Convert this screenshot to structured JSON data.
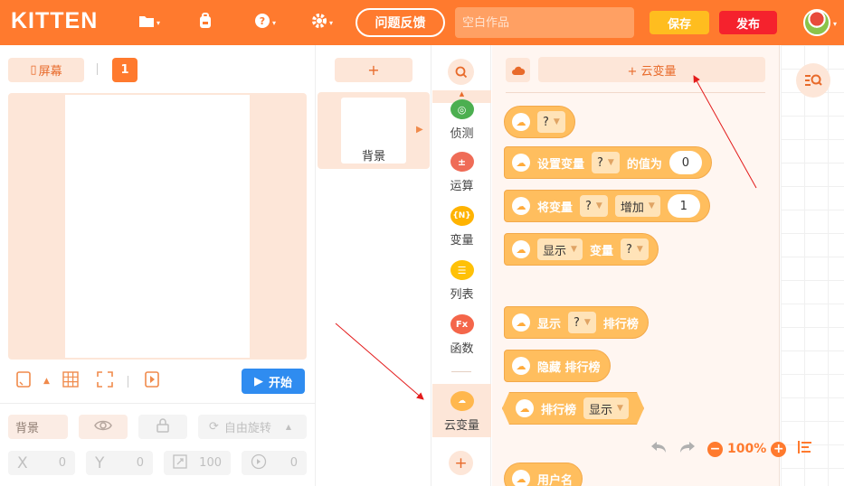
{
  "header": {
    "logo": "KITTEN",
    "feedback_label": "问题反馈",
    "title_placeholder": "空白作品",
    "save_label": "保存",
    "publish_label": "发布"
  },
  "stage": {
    "screen_label": "屏幕",
    "page_number": "1",
    "start_label": "开始"
  },
  "properties": {
    "name": "背景",
    "rotation_label": "自由旋转",
    "x_label": "X",
    "x_value": "0",
    "y_label": "Y",
    "y_value": "0",
    "scale_value": "100",
    "rotation_value": "0"
  },
  "backgrounds": {
    "add_label": "+",
    "items": [
      {
        "label": "背景"
      }
    ]
  },
  "categories": [
    {
      "label": "侦测",
      "icon": "detect-icon",
      "color": "#4caf50"
    },
    {
      "label": "运算",
      "icon": "operator-icon",
      "color": "#ef6c57"
    },
    {
      "label": "变量",
      "icon": "variable-icon",
      "color": "#ffb300"
    },
    {
      "label": "列表",
      "icon": "list-icon",
      "color": "#ffc107"
    },
    {
      "label": "函数",
      "icon": "function-icon",
      "color": "#f4664a"
    },
    {
      "label": "云变量",
      "icon": "cloud-variable-icon",
      "color": "#ffb74d",
      "active": true
    }
  ],
  "blocks_panel": {
    "add_cloud_var_label": "+ 云变量",
    "blocks": {
      "var_getter": {
        "dropdown": "?"
      },
      "set_var": {
        "text1": "设置变量",
        "dropdown": "?",
        "text2": "的值为",
        "value": "0"
      },
      "change_var": {
        "text1": "将变量",
        "dropdown": "?",
        "op": "增加",
        "value": "1"
      },
      "show_var": {
        "op": "显示",
        "text": "变量",
        "dropdown": "?"
      },
      "show_rank": {
        "text1": "显示",
        "dropdown": "?",
        "text2": "排行榜"
      },
      "hide_rank": {
        "text": "隐藏 排行榜"
      },
      "rank_reporter": {
        "text": "排行榜",
        "dropdown": "显示"
      },
      "username": {
        "text": "用户名"
      }
    }
  },
  "zoom": {
    "value": "100%"
  },
  "colors": {
    "brand": "#ff7a2e",
    "save": "#ffbd1f",
    "publish": "#f5222d",
    "start": "#2f8cf0",
    "block": "#ffbe5e"
  }
}
